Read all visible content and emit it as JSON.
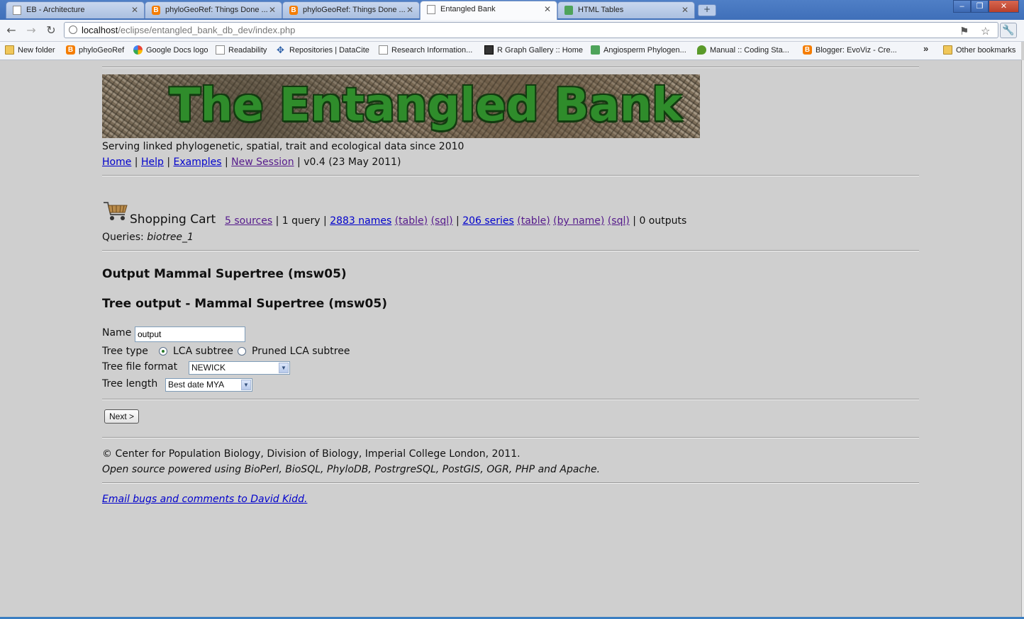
{
  "browser": {
    "tabs": [
      {
        "title": "EB - Architecture",
        "icon": "page-icon"
      },
      {
        "title": "phyloGeoRef: Things Done ...",
        "icon": "blogger-icon"
      },
      {
        "title": "phyloGeoRef: Things Done ...",
        "icon": "blogger-icon"
      },
      {
        "title": "Entangled Bank",
        "icon": "page-icon",
        "active": true
      },
      {
        "title": "HTML Tables",
        "icon": "green-site-icon"
      }
    ],
    "url_host": "localhost",
    "url_path": "/eclipse/entangled_bank_db_dev/index.php",
    "bookmarks": [
      {
        "label": "New folder",
        "icon": "folder-icon"
      },
      {
        "label": "phyloGeoRef",
        "icon": "blogger-icon"
      },
      {
        "label": "Google Docs logo",
        "icon": "google-icon"
      },
      {
        "label": "Readability",
        "icon": "page-icon"
      },
      {
        "label": "Repositories | DataCite",
        "icon": "datacite-icon"
      },
      {
        "label": "Research Information...",
        "icon": "page-icon"
      },
      {
        "label": "R Graph Gallery :: Home",
        "icon": "r-graph-icon"
      },
      {
        "label": "Angiosperm Phylogen...",
        "icon": "green-site-icon"
      },
      {
        "label": "Manual :: Coding Sta...",
        "icon": "leaf-icon"
      },
      {
        "label": "Blogger: EvoViz - Cre...",
        "icon": "blogger-icon"
      }
    ],
    "other_bookmarks": "Other bookmarks",
    "more_chevron": "»",
    "window_buttons": {
      "minimize": "–",
      "restore": "❐",
      "close": "✕"
    }
  },
  "page": {
    "banner_title": "The Entangled Bank",
    "tagline": "Serving linked phylogenetic, spatial, trait and ecological data since 2010",
    "nav": {
      "home": "Home",
      "help": "Help",
      "examples": "Examples",
      "new_session": "New Session",
      "version": "v0.4 (23 May 2011)"
    },
    "cart": {
      "title": "Shopping Cart",
      "sources": "5 sources",
      "query": "1 query",
      "names": "2883 names",
      "names_table": "(table)",
      "names_sql": "(sql)",
      "series": "206 series",
      "series_table": "(table)",
      "series_by_name": "(by name)",
      "series_sql": "(sql)",
      "outputs": "0 outputs",
      "queries_label": "Queries:",
      "queries_value": "biotree_1"
    },
    "output_heading": "Output Mammal Supertree (msw05)",
    "tree_heading": "Tree output - Mammal Supertree (msw05)",
    "form": {
      "name_label": "Name",
      "name_value": "output",
      "tree_type_label": "Tree type",
      "tree_type_options": [
        "LCA subtree",
        "Pruned LCA subtree"
      ],
      "tree_type_selected": "LCA subtree",
      "file_format_label": "Tree file format",
      "file_format_value": "NEWICK",
      "tree_length_label": "Tree length",
      "tree_length_value": "Best date MYA",
      "next_button": "Next >"
    },
    "footer": {
      "copyright": "© Center for Population Biology, Division of Biology, Imperial College London, 2011.",
      "powered": "Open source powered using BioPerl, BioSQL, PhyloDB, PostrgreSQL, PostGIS, OGR, PHP and Apache.",
      "email_link": "Email bugs and comments to David Kidd."
    }
  }
}
